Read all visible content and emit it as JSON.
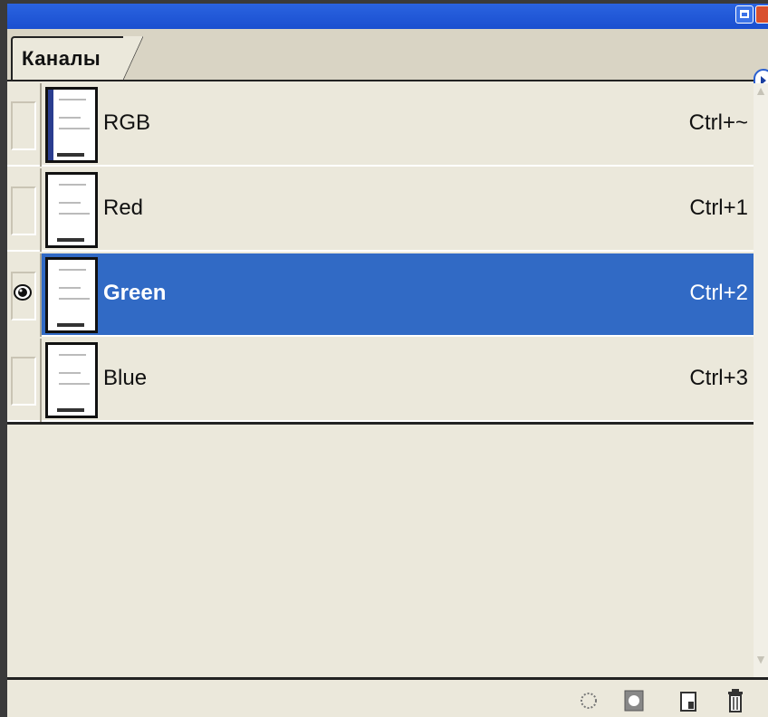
{
  "panel": {
    "tab_label": "Каналы",
    "colors": {
      "accent": "#316ac5",
      "titlebar": "#1a4fd0",
      "panel_bg": "#ebe8db"
    }
  },
  "channels": [
    {
      "name": "RGB",
      "shortcut": "Ctrl+~",
      "visible": false,
      "selected": false,
      "thumb_band": "#2a3d8f"
    },
    {
      "name": "Red",
      "shortcut": "Ctrl+1",
      "visible": false,
      "selected": false,
      "thumb_band": "#ffffff"
    },
    {
      "name": "Green",
      "shortcut": "Ctrl+2",
      "visible": true,
      "selected": true,
      "thumb_band": "#ffffff"
    },
    {
      "name": "Blue",
      "shortcut": "Ctrl+3",
      "visible": false,
      "selected": false,
      "thumb_band": "#ffffff"
    }
  ],
  "footer_icons": [
    "load-selection-icon",
    "save-selection-icon",
    "new-channel-icon",
    "trash-icon"
  ]
}
